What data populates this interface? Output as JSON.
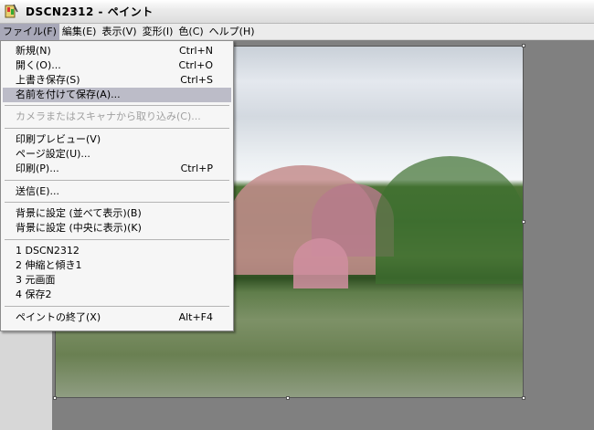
{
  "window": {
    "title": "DSCN2312 - ペイント"
  },
  "menubar": {
    "items": [
      {
        "label": "ファイル(F)",
        "active": true
      },
      {
        "label": "編集(E)"
      },
      {
        "label": "表示(V)"
      },
      {
        "label": "変形(I)"
      },
      {
        "label": "色(C)"
      },
      {
        "label": "ヘルプ(H)"
      }
    ]
  },
  "file_menu": {
    "items": [
      {
        "label": "新規(N)",
        "shortcut": "Ctrl+N"
      },
      {
        "label": "開く(O)...",
        "shortcut": "Ctrl+O"
      },
      {
        "label": "上書き保存(S)",
        "shortcut": "Ctrl+S"
      },
      {
        "label": "名前を付けて保存(A)...",
        "shortcut": ""
      },
      {
        "label": "カメラまたはスキャナから取り込み(C)...",
        "shortcut": ""
      },
      {
        "label": "印刷プレビュー(V)",
        "shortcut": ""
      },
      {
        "label": "ページ設定(U)...",
        "shortcut": ""
      },
      {
        "label": "印刷(P)...",
        "shortcut": "Ctrl+P"
      },
      {
        "label": "送信(E)...",
        "shortcut": ""
      },
      {
        "label": "背景に設定 (並べて表示)(B)",
        "shortcut": ""
      },
      {
        "label": "背景に設定 (中央に表示)(K)",
        "shortcut": ""
      },
      {
        "label": "1 DSCN2312",
        "shortcut": ""
      },
      {
        "label": "2 伸縮と傾き1",
        "shortcut": ""
      },
      {
        "label": "3 元画面",
        "shortcut": ""
      },
      {
        "label": "4 保存2",
        "shortcut": ""
      },
      {
        "label": "ペイントの終了(X)",
        "shortcut": "Alt+F4"
      }
    ]
  },
  "colors": {
    "highlight": "#bcbcc8",
    "menu_bg": "#f6f6f6",
    "workspace": "#808080"
  }
}
